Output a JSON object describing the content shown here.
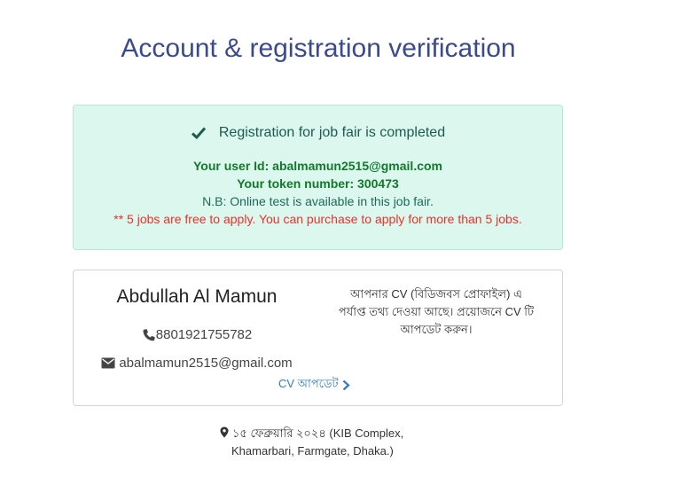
{
  "page": {
    "title": "Account & registration verification"
  },
  "success": {
    "heading": "Registration for job fair is completed",
    "user_id": "Your user Id: abalmamun2515@gmail.com",
    "token": "Your token number: 300473",
    "note": "N.B: Online test is available in this job fair.",
    "warning": "** 5 jobs are free to apply. You can purchase to apply for more than 5 jobs.",
    "icon": "check-icon",
    "colors": {
      "background": "#dcf7ee",
      "heading": "#1d5b4d",
      "bold": "#117a2a",
      "warning": "#e8322b"
    }
  },
  "profile": {
    "name": "Abdullah Al Mamun",
    "phone": "8801921755782",
    "email": "abalmamun2515@gmail.com",
    "cv_message": "আপনার CV (বিডিজবস প্রোফাইল) এ পর্যাপ্ত তথ্য দেওয়া আছে। প্রয়োজনে CV টি আপডেট করুন।",
    "cv_update_link": "CV আপডেট",
    "icons": [
      "phone-icon",
      "mail-icon",
      "chevron-right-icon"
    ],
    "link_color": "#2f7cc0"
  },
  "event": {
    "location_line1": "১৫ ফেব্রুয়ারি ২০২৪ (KIB Complex,",
    "location_line2": "Khamarbari, Farmgate, Dhaka.)",
    "icon": "map-pin-icon"
  }
}
